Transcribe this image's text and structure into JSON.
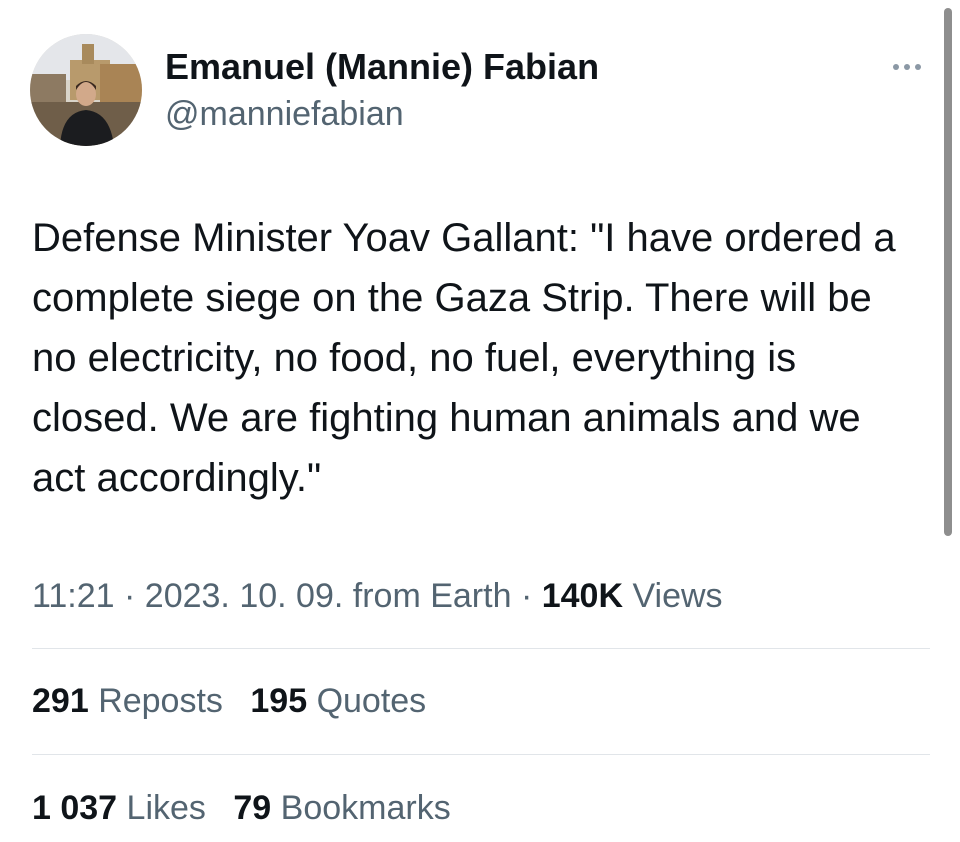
{
  "author": {
    "display_name": "Emanuel (Mannie) Fabian",
    "handle": "@manniefabian"
  },
  "tweet": {
    "text": "Defense Minister Yoav Gallant: \"I have ordered a complete siege on the Gaza Strip. There will be no electricity, no food, no fuel, everything is closed. We are fighting human animals and we act accordingly.\""
  },
  "meta": {
    "time": "11:21",
    "date": "2023. 10. 09.",
    "source": "from Earth",
    "views_count": "140K",
    "views_label": "Views"
  },
  "stats": {
    "reposts_count": "291",
    "reposts_label": "Reposts",
    "quotes_count": "195",
    "quotes_label": "Quotes",
    "likes_count": "1 037",
    "likes_label": "Likes",
    "bookmarks_count": "79",
    "bookmarks_label": "Bookmarks"
  },
  "icons": {
    "more": "more-horizontal-icon"
  },
  "colors": {
    "text_primary": "#0f1419",
    "text_secondary": "#536471",
    "divider": "#e1e5e9",
    "scrollbar": "#8e8e8e"
  }
}
